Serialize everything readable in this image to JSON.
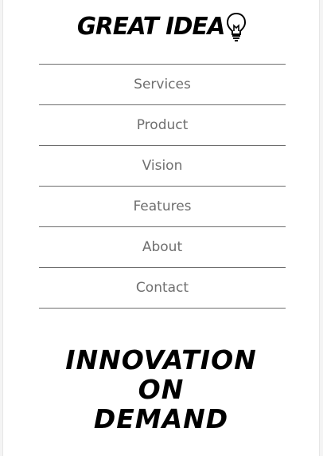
{
  "brand": {
    "title": "GREAT IDEA",
    "icon": "lightbulb-icon"
  },
  "nav": {
    "items": [
      {
        "label": "Services"
      },
      {
        "label": "Product"
      },
      {
        "label": "Vision"
      },
      {
        "label": "Features"
      },
      {
        "label": "About"
      },
      {
        "label": "Contact"
      }
    ]
  },
  "hero": {
    "line1": "INNOVATION",
    "line2": "ON",
    "line3": "DEMAND"
  },
  "colors": {
    "nav_text": "#6f6f6f",
    "divider": "#6e6e6e",
    "background": "#ffffff"
  }
}
